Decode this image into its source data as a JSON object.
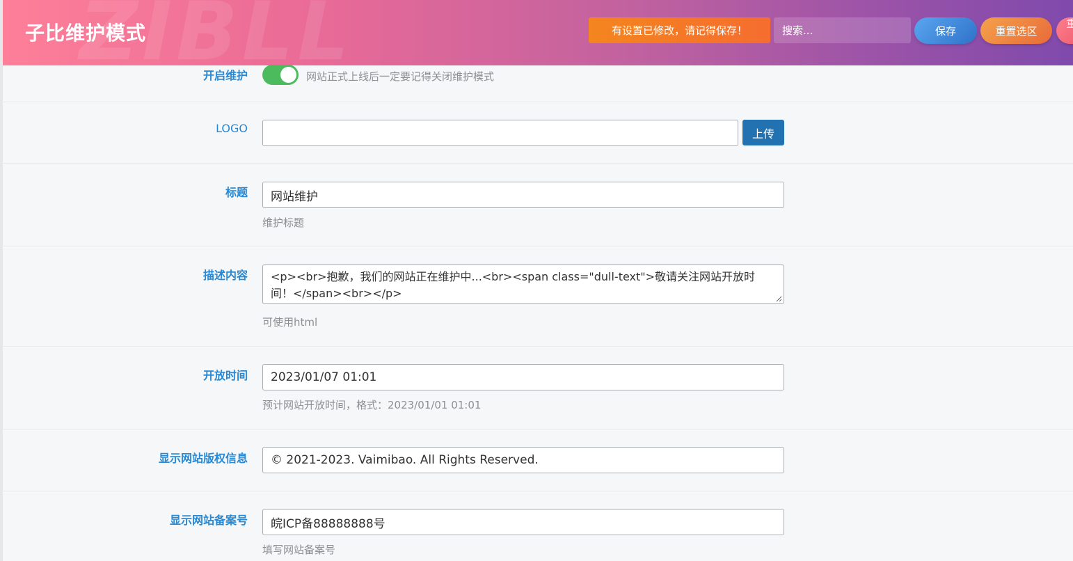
{
  "header": {
    "title": "子比维护模式",
    "watermark": "ZIBLL",
    "notice": "有设置已修改，请记得保存！",
    "search_placeholder": "搜索...",
    "save_label": "保存",
    "reset_label": "重置选区",
    "more_label": "重置全部",
    "colors": {
      "notice": "#f4851f",
      "save": "#2f72c9",
      "reset": "#e86a3a",
      "accent": "#2789d6"
    }
  },
  "fields": {
    "maintenance": {
      "label": "开启维护",
      "enabled": true,
      "help": "网站正式上线后一定要记得关闭维护模式"
    },
    "logo": {
      "label": "LOGO",
      "value": "",
      "upload_label": "上传"
    },
    "title": {
      "label": "标题",
      "value": "网站维护",
      "help": "维护标题"
    },
    "description": {
      "label": "描述内容",
      "value": "<p><br>抱歉，我们的网站正在维护中...<br><span class=\"dull-text\">敬请关注网站开放时间！</span><br></p>",
      "help": "可使用html"
    },
    "open_time": {
      "label": "开放时间",
      "value": "2023/01/07 01:01",
      "help": "预计网站开放时间，格式：2023/01/01 01:01"
    },
    "copyright": {
      "label": "显示网站版权信息",
      "value": "© 2021-2023. Vaimibao. All Rights Reserved."
    },
    "icp": {
      "label": "显示网站备案号",
      "value": "皖ICP备88888888号",
      "help": "填写网站备案号"
    }
  }
}
